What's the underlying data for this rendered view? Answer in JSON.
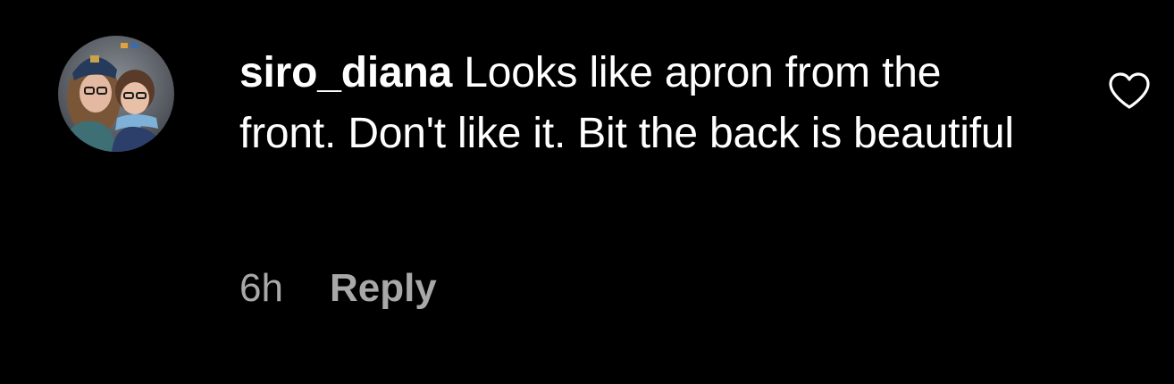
{
  "comment": {
    "username": "siro_diana",
    "text": "Looks like apron from the front. Don't like it. Bit the back is beautiful",
    "time": "6h",
    "reply_label": "Reply"
  },
  "icons": {
    "like": "heart-outline-icon",
    "avatar": "profile-photo"
  },
  "colors": {
    "background": "#000000",
    "primary_text": "#ffffff",
    "secondary_text": "#a8a8a8"
  }
}
